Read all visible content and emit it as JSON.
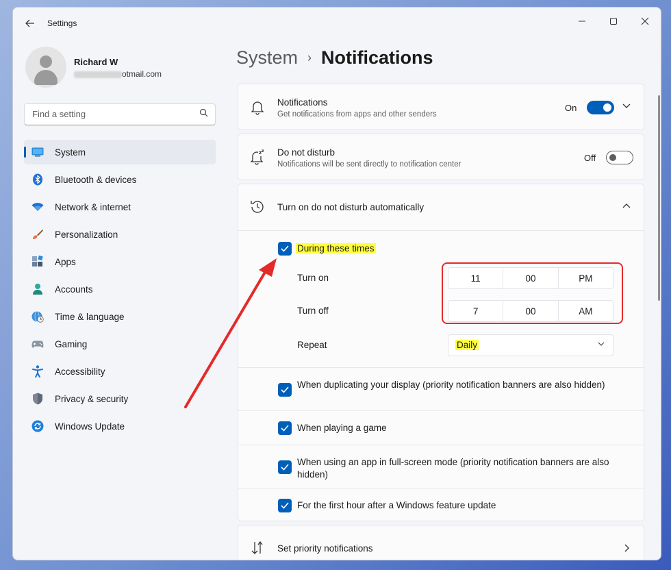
{
  "window": {
    "title": "Settings",
    "controls": [
      "—",
      "☐",
      "✕"
    ]
  },
  "user": {
    "name": "Richard W",
    "email_suffix": "otmail.com"
  },
  "search": {
    "placeholder": "Find a setting"
  },
  "sidebar": {
    "items": [
      {
        "label": "System",
        "icon": "system-icon",
        "active": true
      },
      {
        "label": "Bluetooth & devices",
        "icon": "bluetooth-icon"
      },
      {
        "label": "Network & internet",
        "icon": "wifi-icon"
      },
      {
        "label": "Personalization",
        "icon": "brush-icon"
      },
      {
        "label": "Apps",
        "icon": "apps-icon"
      },
      {
        "label": "Accounts",
        "icon": "accounts-icon"
      },
      {
        "label": "Time & language",
        "icon": "globe-clock-icon"
      },
      {
        "label": "Gaming",
        "icon": "controller-icon"
      },
      {
        "label": "Accessibility",
        "icon": "accessibility-icon"
      },
      {
        "label": "Privacy & security",
        "icon": "shield-icon"
      },
      {
        "label": "Windows Update",
        "icon": "update-icon"
      }
    ]
  },
  "breadcrumb": {
    "parent": "System",
    "separator": "›",
    "current": "Notifications"
  },
  "notifications": {
    "title": "Notifications",
    "subtitle": "Get notifications from apps and other senders",
    "state": "On"
  },
  "dnd": {
    "title": "Do not disturb",
    "subtitle": "Notifications will be sent directly to notification center",
    "state": "Off"
  },
  "auto_dnd": {
    "title": "Turn on do not disturb automatically",
    "during_times": "During these times",
    "turn_on_label": "Turn on",
    "turn_on": {
      "hour": "11",
      "minute": "00",
      "period": "PM"
    },
    "turn_off_label": "Turn off",
    "turn_off": {
      "hour": "7",
      "minute": "00",
      "period": "AM"
    },
    "repeat_label": "Repeat",
    "repeat_value": "Daily",
    "options": [
      "When duplicating your display (priority notification banners are also hidden)",
      "When playing a game",
      "When using an app in full-screen mode (priority notification banners are also hidden)",
      "For the first hour after a Windows feature update"
    ]
  },
  "priority": {
    "title": "Set priority notifications"
  },
  "colors": {
    "accent": "#005fb8",
    "highlight": "#ffff3b",
    "annotation": "#e52a2a"
  }
}
